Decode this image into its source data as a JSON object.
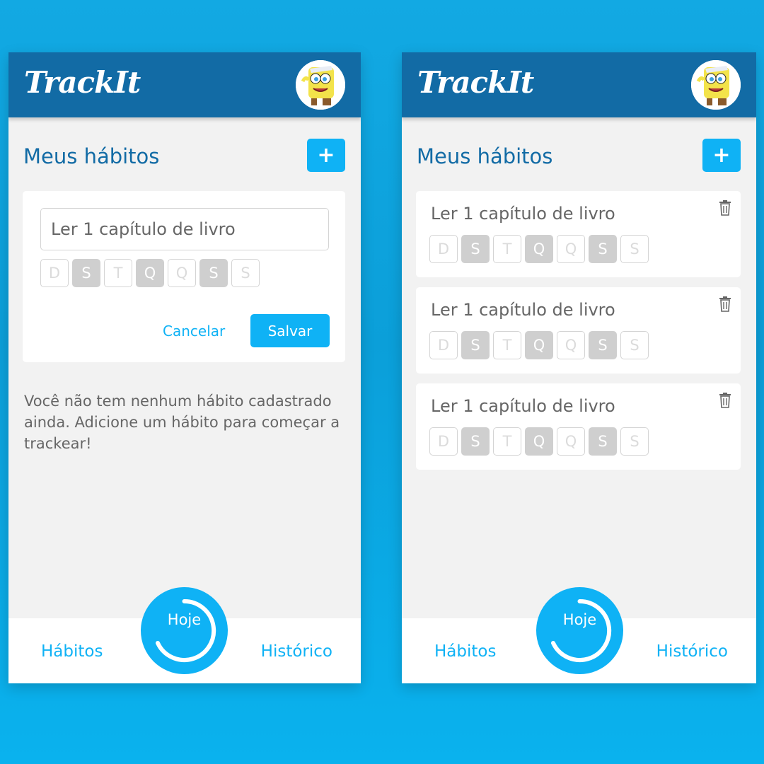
{
  "app": {
    "logo": "TrackIt"
  },
  "colors": {
    "header": "#126ba5",
    "accent": "#0fb2f5",
    "background": "#0b9fd9"
  },
  "left_screen": {
    "section_title": "Meus hábitos",
    "add_button": "+",
    "form": {
      "habit_name_value": "Ler 1 capítulo de livro",
      "days": [
        {
          "label": "D",
          "selected": false
        },
        {
          "label": "S",
          "selected": true
        },
        {
          "label": "T",
          "selected": false
        },
        {
          "label": "Q",
          "selected": true
        },
        {
          "label": "Q",
          "selected": false
        },
        {
          "label": "S",
          "selected": true
        },
        {
          "label": "S",
          "selected": false
        }
      ],
      "cancel_label": "Cancelar",
      "save_label": "Salvar"
    },
    "empty_message": "Você não tem nenhum hábito cadastrado ainda. Adicione um hábito para começar a trackear!",
    "nav": {
      "habits": "Hábitos",
      "today": "Hoje",
      "history": "Histórico"
    }
  },
  "right_screen": {
    "section_title": "Meus hábitos",
    "add_button": "+",
    "habits": [
      {
        "name": "Ler 1 capítulo de livro"
      },
      {
        "name": "Ler 1 capítulo de livro"
      },
      {
        "name": "Ler 1 capítulo de livro"
      }
    ],
    "days": [
      {
        "label": "D",
        "selected": false
      },
      {
        "label": "S",
        "selected": true
      },
      {
        "label": "T",
        "selected": false
      },
      {
        "label": "Q",
        "selected": true
      },
      {
        "label": "Q",
        "selected": false
      },
      {
        "label": "S",
        "selected": true
      },
      {
        "label": "S",
        "selected": false
      }
    ],
    "nav": {
      "habits": "Hábitos",
      "today": "Hoje",
      "history": "Histórico"
    }
  },
  "icons": {
    "avatar": "spongebob-avatar",
    "delete": "trash-icon",
    "today_progress": "progress-ring"
  }
}
